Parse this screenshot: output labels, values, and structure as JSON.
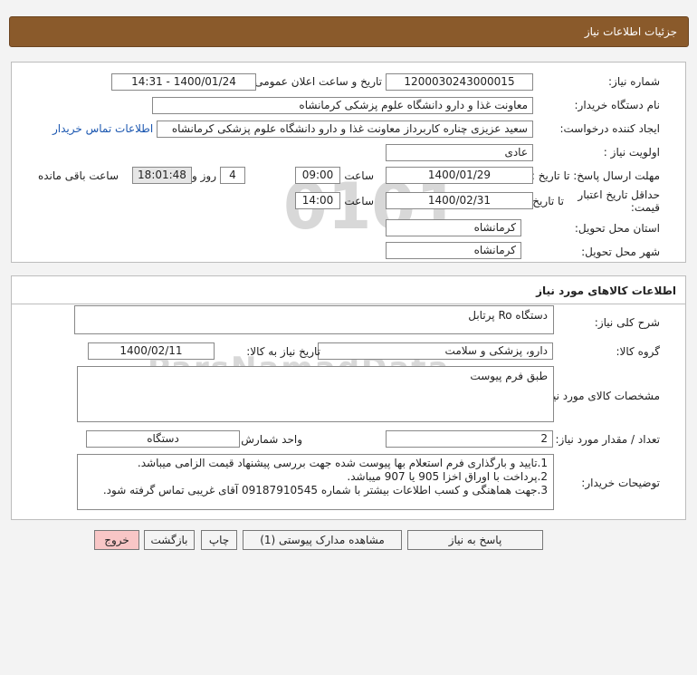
{
  "header": {
    "title": "جزئیات اطلاعات نیاز"
  },
  "info": {
    "need_number_label": "شماره نیاز:",
    "need_number": "1200030243000015",
    "announce_label": "تاریخ و ساعت اعلان عمومی:",
    "announce_value": "1400/01/24 - 14:31",
    "buyer_label": "نام دستگاه خریدار:",
    "buyer": "معاونت غذا و دارو دانشگاه علوم پزشکی کرمانشاه",
    "creator_label": "ایجاد کننده درخواست:",
    "creator": "سعید عزیزی چناره کاربرداز معاونت غذا و دارو دانشگاه علوم پزشکی کرمانشاه",
    "contact_link": "اطلاعات تماس خریدار",
    "priority_label": "اولویت نیاز :",
    "priority": "عادی",
    "deadline_label": "مهلت ارسال پاسخ: تا تاریخ :",
    "deadline_date": "1400/01/29",
    "time_label": "ساعت",
    "deadline_time": "09:00",
    "days_value": "4",
    "days_label": "روز و",
    "remaining_time": "18:01:48",
    "remaining_label": "ساعت باقی مانده",
    "validity_label": "حداقل تاریخ اعتبار قیمت:",
    "validity_to": "تا تاریخ :",
    "validity_date": "1400/02/31",
    "validity_time": "14:00",
    "province_label": "استان محل تحویل:",
    "province": "کرمانشاه",
    "city_label": "شهر محل تحویل:",
    "city": "کرمانشاه"
  },
  "goods": {
    "section_title": "اطلاعات کالاهای مورد نیاز",
    "desc_label": "شرح کلی نیاز:",
    "desc": "دستگاه Ro پرتابل",
    "group_label": "گروه کالا:",
    "group": "دارو، پزشکی و سلامت",
    "need_date_label": "تاریخ نیاز به کالا:",
    "need_date": "1400/02/11",
    "specs_label": "مشخصات کالای مورد نیاز:",
    "specs": "طبق فرم پیوست",
    "qty_label": "تعداد / مقدار مورد نیاز:",
    "qty": "2",
    "unit_label": "واحد شمارش:",
    "unit": "دستگاه",
    "notes_label": "توضیحات خریدار:",
    "notes": [
      "1.تایید و بارگذاری فرم استعلام بها پیوست شده جهت بررسی پیشنهاد قیمت الزامی میباشد.",
      "2.پرداخت با اوراق اخزا 905 یا 907 میباشد.",
      "3.جهت هماهنگی و کسب اطلاعات بیشتر با شماره 09187910545 آقای غریبی تماس گرفته شود."
    ]
  },
  "buttons": {
    "respond": "پاسخ به نیاز",
    "attachments": "مشاهده مدارک پیوستی (1)",
    "print": "چاپ",
    "back": "بازگشت",
    "exit": "خروج"
  }
}
